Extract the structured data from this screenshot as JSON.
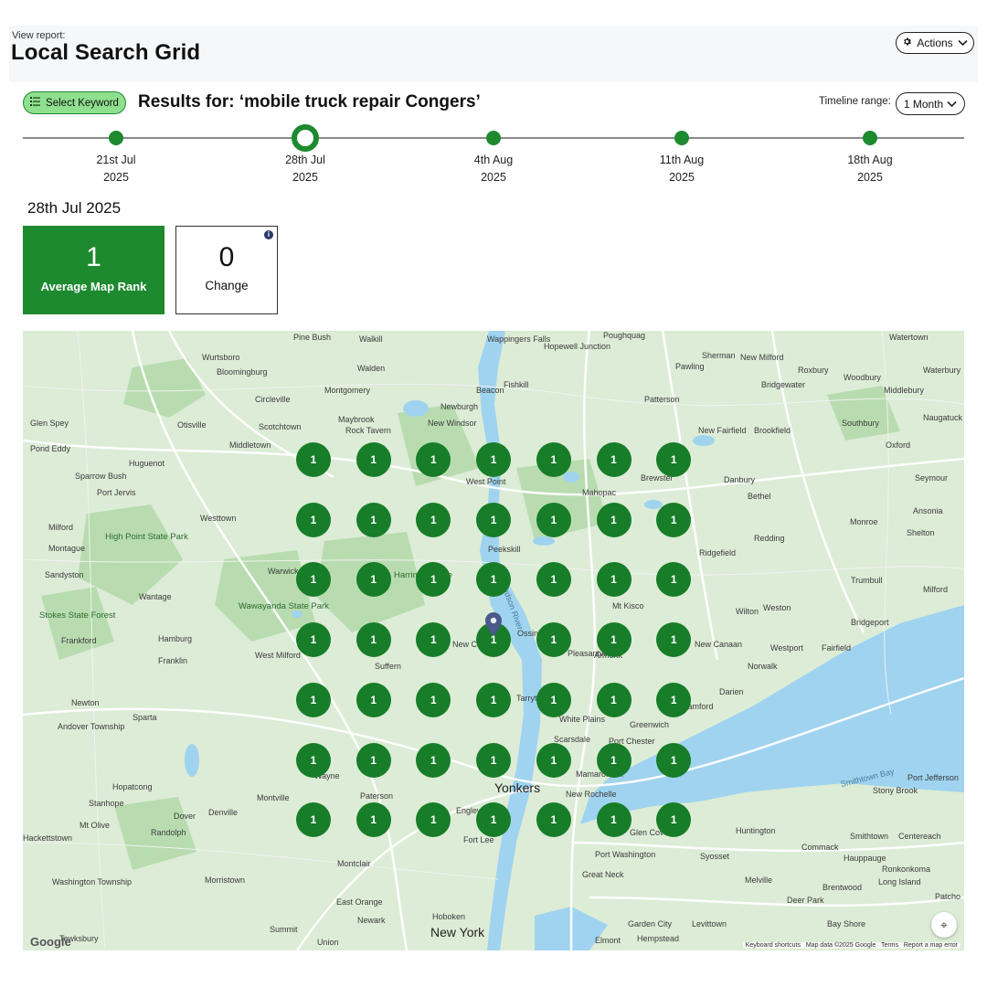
{
  "header": {
    "subtitle": "View report:",
    "title": "Local Search Grid",
    "actions_label": "Actions"
  },
  "toolbar": {
    "keyword_button": "Select Keyword",
    "results_text": "Results for: ‘mobile truck repair Congers’",
    "timeline_range_label": "Timeline range:",
    "timeline_range_value": "1 Month"
  },
  "timeline": [
    {
      "date": "21st Jul",
      "year": "2025",
      "active": false
    },
    {
      "date": "28th Jul",
      "year": "2025",
      "active": true
    },
    {
      "date": "4th Aug",
      "year": "2025",
      "active": false
    },
    {
      "date": "11th Aug",
      "year": "2025",
      "active": false
    },
    {
      "date": "18th Aug",
      "year": "2025",
      "active": false
    }
  ],
  "selected_date": "28th Jul 2025",
  "stats": {
    "average_rank_value": "1",
    "average_rank_label": "Average Map Rank",
    "change_value": "0",
    "change_label": "Change"
  },
  "map": {
    "grid_rows": 7,
    "grid_cols": 7,
    "grid_ranks": [
      [
        "1",
        "1",
        "1",
        "1",
        "1",
        "1",
        "1"
      ],
      [
        "1",
        "1",
        "1",
        "1",
        "1",
        "1",
        "1"
      ],
      [
        "1",
        "1",
        "1",
        "1",
        "1",
        "1",
        "1"
      ],
      [
        "1",
        "1",
        "1",
        "1",
        "1",
        "1",
        "1"
      ],
      [
        "1",
        "1",
        "1",
        "1",
        "1",
        "1",
        "1"
      ],
      [
        "1",
        "1",
        "1",
        "1",
        "1",
        "1",
        "1"
      ],
      [
        "1",
        "1",
        "1",
        "1",
        "1",
        "1",
        "1"
      ]
    ],
    "marker_color": "#177d28",
    "places": [
      "Pine Bush",
      "Walkill",
      "Wappingers Falls",
      "Hopewell Junction",
      "Poughquag",
      "Watertown",
      "Wurtsboro",
      "Sherman",
      "New Milford",
      "Bloomingburg",
      "Walden",
      "Fishkill",
      "Pawling",
      "Roxbury",
      "Woodbury",
      "Waterbury",
      "Montgomery",
      "Beacon",
      "Bridgewater",
      "Circleville",
      "Newburgh",
      "Patterson",
      "Middlebury",
      "Glen Spey",
      "Otisville",
      "Maybrook",
      "Rock Tavern",
      "New Windsor",
      "Scotchtown",
      "Southbury",
      "Naugatuck",
      "New Fairfield",
      "Brookfield",
      "Pond Eddy",
      "Middletown",
      "Oxford",
      "Huguenot",
      "Sparrow Bush",
      "West Point",
      "Brewster",
      "Danbury",
      "Seymour",
      "Port Jervis",
      "Mahopac",
      "Bethel",
      "Ansonia",
      "Milford",
      "Westtown",
      "Monroe",
      "Shelton",
      "High Point State Park",
      "Montague",
      "Peekskill",
      "Ridgefield",
      "Redding",
      "Sandyston",
      "Warwick",
      "Harriman State",
      "Trumbull",
      "Wantage",
      "Wawayanda State Park",
      "Mt Kisco",
      "Wilton",
      "Weston",
      "Milford",
      "Stokes State Forest",
      "Hamburg",
      "New City",
      "Ossining",
      "Bridgeport",
      "Frankford",
      "West Milford",
      "Armonk",
      "New Canaan",
      "Westport",
      "Fairfield",
      "Franklin",
      "Suffern",
      "Pleasantville",
      "Norwalk",
      "Darien",
      "Tarrytown",
      "Newton",
      "Sparta",
      "White Plains",
      "Stamford",
      "Andover Township",
      "Greenwich",
      "Port Chester",
      "Scarsdale",
      "Wayne",
      "Mamaroneck",
      "Port Jefferson",
      "Hopatcong",
      "Montville",
      "Yonkers",
      "New Rochelle",
      "Stony Brook",
      "Stanhope",
      "Paterson",
      "Mt Olive",
      "Dover",
      "Denville",
      "Randolph",
      "Englewood",
      "Huntington",
      "Glen Cove",
      "Smithtown",
      "Centereach",
      "Hackettstown",
      "Fort Lee",
      "Commack",
      "Montclair",
      "Port Washington",
      "Syosset",
      "Hauppauge",
      "Ronkonkoma",
      "Washington Township",
      "Morristown",
      "Great Neck",
      "Melville",
      "Brentwood",
      "Long Island",
      "East Orange",
      "Deer Park",
      "Patcho",
      "Newark",
      "Hoboken",
      "Garden City",
      "Levittown",
      "Bay Shore",
      "Summit",
      "New York",
      "Union",
      "Elmont",
      "Hempstead",
      "Tewksbury",
      "Smithtown Bay",
      "Hudson River"
    ],
    "attribution": "Google",
    "footer_keyboard": "Keyboard shortcuts",
    "footer_data": "Map data ©2025 Google",
    "footer_terms": "Terms",
    "footer_report": "Report a map error",
    "colors": {
      "land": "#dcecd6",
      "forest": "#b8dcb0",
      "water": "#9fd3ef",
      "road": "#ffffff"
    }
  }
}
